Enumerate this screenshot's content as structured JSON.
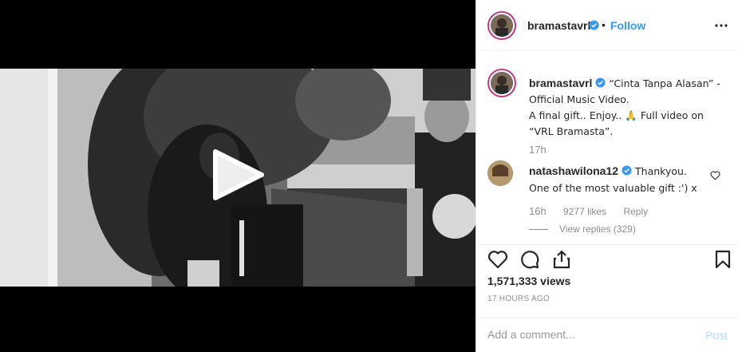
{
  "post": {
    "username": "bramastavrl",
    "dot": "•",
    "follow_label": "Follow",
    "more_icon": "more-options-icon",
    "verified_icon": "verified-badge-icon"
  },
  "caption": {
    "username": "bramastavrl",
    "line1": " “Cinta Tanpa Alasan” - Official Music Video.",
    "line2": "A final gift.. Enjoy.. ",
    "emoji": "🙏",
    "line3": " Full video on “VRL Bramasta”.",
    "time": "17h"
  },
  "comment": {
    "username": "natashawilona12",
    "text": " Thankyou. One of the most valuable gift :') x",
    "time": "16h",
    "likes": "9277 likes",
    "reply_label": "Reply",
    "view_replies": "View replies (329)"
  },
  "actions": {
    "views": "1,571,333 views",
    "posted": "17 HOURS AGO",
    "icons": [
      "heart-icon",
      "comment-icon",
      "share-icon",
      "bookmark-icon"
    ]
  },
  "comment_box": {
    "placeholder": "Add a comment...",
    "post_label": "Post"
  },
  "colors": {
    "link": "#3897f0",
    "muted": "#8e8e8e",
    "post_disabled": "#b2dffc",
    "story_ring": "#c13584"
  }
}
